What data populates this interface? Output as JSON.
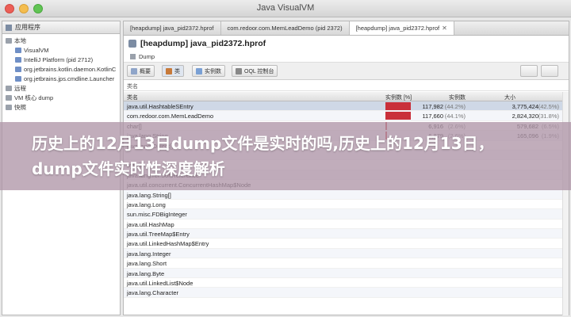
{
  "window": {
    "title": "Java VisualVM"
  },
  "sidebar": {
    "tab_label": "应用程序",
    "items": [
      {
        "label": "本地",
        "icon": "computer-icon"
      },
      {
        "label": "VisualVM",
        "icon": "app-icon"
      },
      {
        "label": "IntelliJ Platform (pid 2712)",
        "icon": "app-icon"
      },
      {
        "label": "org.jetbrains.kotlin.daemon.KotlinC",
        "icon": "app-icon"
      },
      {
        "label": "org.jetbrains.jps.cmdline.Launcher",
        "icon": "app-icon"
      },
      {
        "label": "远程",
        "icon": "remote-icon"
      },
      {
        "label": "VM 核心 dump",
        "icon": "dump-icon"
      },
      {
        "label": "快照",
        "icon": "snapshot-icon"
      }
    ]
  },
  "tabs": [
    {
      "label": "[heapdump] java_pid2372.hprof"
    },
    {
      "label": "com.redoor.com.MemLeadDemo (pid 2372)"
    },
    {
      "label": "[heapdump] java_pid2372.hprof"
    }
  ],
  "main": {
    "heading": "[heapdump] java_pid2372.hprof",
    "subtab": "Dump",
    "toolbar": {
      "summary": "概要",
      "classes": "类",
      "instances": "实例数",
      "oql": "OQL 控制台"
    },
    "summary_row": "类名",
    "columns": {
      "name": "类名",
      "instances_pct": "实例数 [%]",
      "instances": "实例数",
      "size": "大小"
    }
  },
  "rows": [
    {
      "name": "java.util.HashtableSEntry",
      "pct": 100,
      "instances": "117,982",
      "ipct": "(44.2%)",
      "size": "3,775,424",
      "spct": "(42.5%)"
    },
    {
      "name": "com.redoor.com.MemLeadDemo",
      "pct": 99.7,
      "instances": "117,660",
      "ipct": "(44.1%)",
      "size": "2,824,320",
      "spct": "(31.8%)"
    },
    {
      "name": "char[]",
      "pct": 5.9,
      "instances": "6,916",
      "ipct": "(2.6%)",
      "size": "579,682",
      "spct": "(6.5%)"
    },
    {
      "name": "java.lang.String",
      "pct": 5.8,
      "instances": "6,879",
      "ipct": "(2.6%)",
      "size": "165,096",
      "spct": "(1.9%)"
    },
    {
      "name": "java.lang.Object[]",
      "pct": 0,
      "instances": "",
      "ipct": "",
      "size": "",
      "spct": ""
    },
    {
      "name": "",
      "pct": 0,
      "instances": "",
      "ipct": "",
      "size": "",
      "spct": ""
    },
    {
      "name": "byte[]",
      "pct": 0,
      "instances": "",
      "ipct": "",
      "size": "",
      "spct": ""
    },
    {
      "name": "java.lang.ref.SoftReference",
      "pct": 0,
      "instances": "",
      "ipct": "",
      "size": "",
      "spct": ""
    },
    {
      "name": "java.util.concurrent.ConcurrentHashMap$Node",
      "pct": 0,
      "instances": "",
      "ipct": "",
      "size": "",
      "spct": ""
    },
    {
      "name": "java.lang.String[]",
      "pct": 0,
      "instances": "",
      "ipct": "",
      "size": "",
      "spct": ""
    },
    {
      "name": "java.lang.Long",
      "pct": 0,
      "instances": "",
      "ipct": "",
      "size": "",
      "spct": ""
    },
    {
      "name": "sun.misc.FDBigInteger",
      "pct": 0,
      "instances": "",
      "ipct": "",
      "size": "",
      "spct": ""
    },
    {
      "name": "java.util.HashMap",
      "pct": 0,
      "instances": "",
      "ipct": "",
      "size": "",
      "spct": ""
    },
    {
      "name": "java.util.TreeMap$Entry",
      "pct": 0,
      "instances": "",
      "ipct": "",
      "size": "",
      "spct": ""
    },
    {
      "name": "java.util.LinkedHashMap$Entry",
      "pct": 0,
      "instances": "",
      "ipct": "",
      "size": "",
      "spct": ""
    },
    {
      "name": "java.lang.Integer",
      "pct": 0,
      "instances": "",
      "ipct": "",
      "size": "",
      "spct": ""
    },
    {
      "name": "java.lang.Short",
      "pct": 0,
      "instances": "",
      "ipct": "",
      "size": "",
      "spct": ""
    },
    {
      "name": "java.lang.Byte",
      "pct": 0,
      "instances": "",
      "ipct": "",
      "size": "",
      "spct": ""
    },
    {
      "name": "java.util.LinkedList$Node",
      "pct": 0,
      "instances": "",
      "ipct": "",
      "size": "",
      "spct": ""
    },
    {
      "name": "java.lang.Character",
      "pct": 0,
      "instances": "",
      "ipct": "",
      "size": "",
      "spct": ""
    }
  ],
  "overlay": {
    "text": "历史上的12月13日dump文件是实时的吗,历史上的12月13日，dump文件实时性深度解析"
  }
}
